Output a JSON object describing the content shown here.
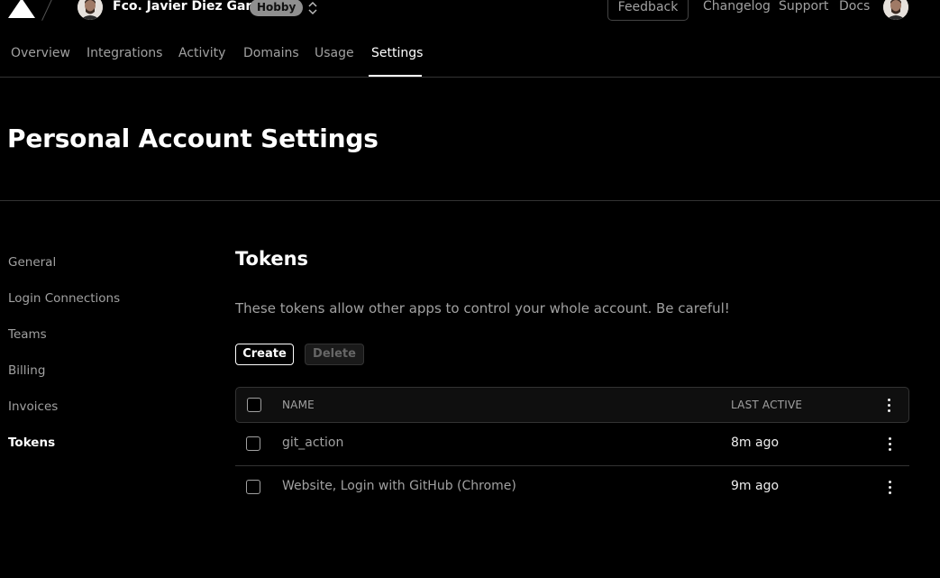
{
  "header": {
    "user_name": "Fco. Javier Diez Garcia",
    "plan_badge": "Hobby",
    "feedback_label": "Feedback",
    "links": [
      "Changelog",
      "Support",
      "Docs"
    ]
  },
  "tabs": [
    {
      "label": "Overview",
      "active": false
    },
    {
      "label": "Integrations",
      "active": false
    },
    {
      "label": "Activity",
      "active": false
    },
    {
      "label": "Domains",
      "active": false
    },
    {
      "label": "Usage",
      "active": false
    },
    {
      "label": "Settings",
      "active": true
    }
  ],
  "page_title": "Personal Account Settings",
  "sidebar": {
    "items": [
      {
        "label": "General",
        "active": false
      },
      {
        "label": "Login Connections",
        "active": false
      },
      {
        "label": "Teams",
        "active": false
      },
      {
        "label": "Billing",
        "active": false
      },
      {
        "label": "Invoices",
        "active": false
      },
      {
        "label": "Tokens",
        "active": true
      }
    ]
  },
  "tokens": {
    "title": "Tokens",
    "description": "These tokens allow other apps to control your whole account. Be careful!",
    "create_label": "Create",
    "delete_label": "Delete",
    "columns": [
      "NAME",
      "LAST ACTIVE"
    ],
    "rows": [
      {
        "name": "git_action",
        "last_active": "8m ago"
      },
      {
        "name": "Website, Login with GitHub (Chrome)",
        "last_active": "9m ago"
      }
    ]
  },
  "icons": {
    "logo": "triangle-logo-icon",
    "switcher": "chevron-up-down-icon",
    "row_menu": "more-vertical-icon"
  }
}
